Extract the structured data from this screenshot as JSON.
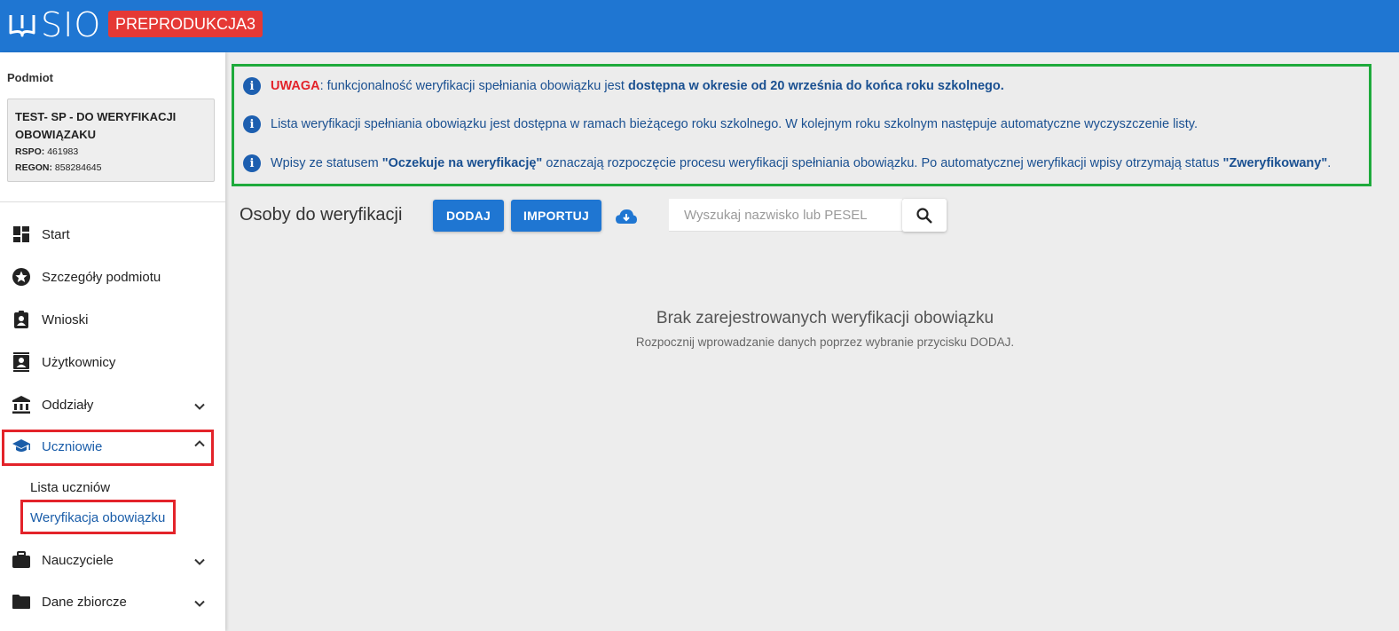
{
  "header": {
    "logo_text": "SIO",
    "env_badge": "PREPRODUKCJA3",
    "brand_color": "#1f76d2",
    "badge_color": "#e53935"
  },
  "sidebar": {
    "podmiot_label": "Podmiot",
    "podmiot": {
      "name": "TEST- SP - DO WERYFIKACJI OBOWIĄZAKU",
      "rspo_label": "RSPO:",
      "rspo": "461983",
      "regon_label": "REGON:",
      "regon": "858284645"
    },
    "items": [
      {
        "label": "Start",
        "icon": "dashboard-icon"
      },
      {
        "label": "Szczegóły podmiotu",
        "icon": "star-icon"
      },
      {
        "label": "Wnioski",
        "icon": "clipboard-account-icon"
      },
      {
        "label": "Użytkownicy",
        "icon": "contacts-icon"
      },
      {
        "label": "Oddziały",
        "icon": "bank-icon",
        "expandable": true
      },
      {
        "label": "Uczniowie",
        "icon": "school-icon",
        "expandable": true,
        "expanded": true
      },
      {
        "label": "Nauczyciele",
        "icon": "briefcase-icon",
        "expandable": true
      },
      {
        "label": "Dane zbiorcze",
        "icon": "folder-icon",
        "expandable": true
      }
    ],
    "uczniowie_sub": [
      {
        "label": "Lista uczniów"
      },
      {
        "label": "Weryfikacja obowiązku",
        "active": true
      }
    ]
  },
  "info": {
    "row1": {
      "uwaga": "UWAGA",
      "text": ": funkcjonalność weryfikacji spełniania obowiązku jest ",
      "bold": "dostępna w okresie od 20 września do końca roku szkolnego."
    },
    "row2": {
      "text": "Lista weryfikacji spełniania obowiązku jest dostępna w ramach bieżącego roku szkolnego. W kolejnym roku szkolnym następuje automatyczne wyczyszczenie listy."
    },
    "row3": {
      "text1": "Wpisy ze statusem ",
      "bold1": "\"Oczekuje na weryfikację\"",
      "text2": " oznaczają rozpoczęcie procesu weryfikacji spełniania obowiązku. Po automatycznej weryfikacji wpisy otrzymają status ",
      "bold2": "\"Zweryfikowany\"",
      "text3": "."
    }
  },
  "toolbar": {
    "title": "Osoby do weryfikacji",
    "add_label": "DODAJ",
    "import_label": "IMPORTUJ",
    "search_placeholder": "Wyszukaj nazwisko lub PESEL"
  },
  "empty_state": {
    "title": "Brak zarejestrowanych weryfikacji obowiązku",
    "subtitle": "Rozpocznij wprowadzanie danych poprzez wybranie przycisku DODAJ."
  }
}
